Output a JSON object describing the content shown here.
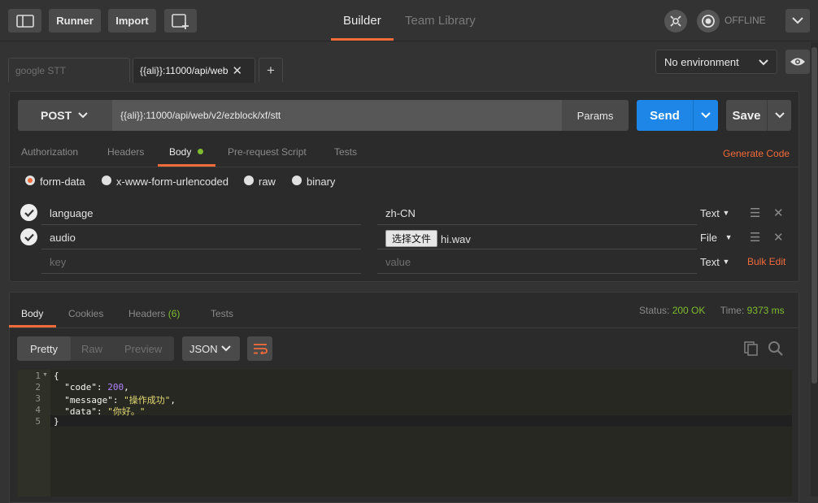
{
  "topbar": {
    "runner_label": "Runner",
    "import_label": "Import",
    "tabs": [
      {
        "label": "Builder",
        "active": true
      },
      {
        "label": "Team Library",
        "active": false
      }
    ],
    "sync_status": "OFFLINE"
  },
  "request_tabs": [
    {
      "label": "google STT",
      "active": false
    },
    {
      "label": "{{ali}}:11000/api/web",
      "active": true
    }
  ],
  "environment": {
    "selected": "No environment"
  },
  "request": {
    "method": "POST",
    "url": "{{ali}}:11000/api/web/v2/ezblock/xf/stt",
    "params_label": "Params",
    "send_label": "Send",
    "save_label": "Save",
    "subtabs": [
      {
        "label": "Authorization"
      },
      {
        "label": "Headers"
      },
      {
        "label": "Body",
        "active": true
      },
      {
        "label": "Pre-request Script"
      },
      {
        "label": "Tests"
      }
    ],
    "generate_code_label": "Generate Code",
    "body_modes": [
      {
        "label": "form-data",
        "selected": true
      },
      {
        "label": "x-www-form-urlencoded",
        "selected": false
      },
      {
        "label": "raw",
        "selected": false
      },
      {
        "label": "binary",
        "selected": false
      }
    ],
    "form_rows": [
      {
        "key": "language",
        "value": "zh-CN",
        "type": "Text",
        "checked": true
      },
      {
        "key": "audio",
        "file_button": "选择文件",
        "file_name": "hi.wav",
        "type": "File",
        "checked": true
      }
    ],
    "new_row": {
      "key_placeholder": "key",
      "value_placeholder": "value",
      "type": "Text"
    },
    "bulk_edit_label": "Bulk Edit"
  },
  "response": {
    "tabs": [
      {
        "label": "Body",
        "active": true
      },
      {
        "label": "Cookies"
      },
      {
        "label": "Headers",
        "count": "(6)"
      },
      {
        "label": "Tests"
      }
    ],
    "status_label": "Status:",
    "status_value": "200 OK",
    "time_label": "Time:",
    "time_value": "9373 ms",
    "format_tabs": [
      "Pretty",
      "Raw",
      "Preview"
    ],
    "language": "JSON",
    "code_lines": [
      {
        "n": "1",
        "text": "{"
      },
      {
        "n": "2",
        "key": "\"code\"",
        "num": "200"
      },
      {
        "n": "3",
        "key": "\"message\"",
        "str": "\"操作成功\""
      },
      {
        "n": "4",
        "key": "\"data\"",
        "str": "\"你好。\""
      },
      {
        "n": "5",
        "text": "}"
      }
    ]
  },
  "colors": {
    "accent": "#f26b3a",
    "send_blue": "#1d86e6",
    "status_green": "#7fbb2f",
    "code_number": "#ae81ff",
    "code_string": "#e6db74"
  }
}
